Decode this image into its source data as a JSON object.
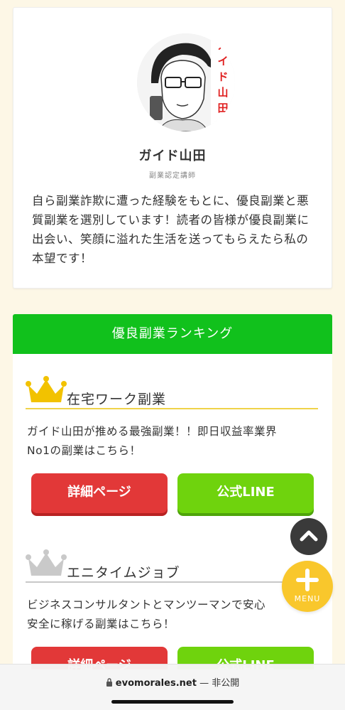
{
  "profile": {
    "avatar_text": "ガイド山田",
    "name": "ガイド山田",
    "role": "副業認定講師",
    "bio": "自ら副業詐欺に遭った経験をもとに、優良副業と悪質副業を選別しています！読者の皆様が優良副業に出会い、笑顔に溢れた生活を送ってもらえたら私の本望です！"
  },
  "ranking": {
    "header": "優良副業ランキング",
    "items": [
      {
        "title": "在宅ワーク副業",
        "desc_line1": "ガイド山田が推める最強副業！！即日収益率業界",
        "desc_line2": "No1の副業はこちら！",
        "detail_button": "詳細ページ",
        "line_button": "公式LINE",
        "crown": "gold-crown-icon"
      },
      {
        "title": "エニタイムジョブ",
        "desc_line1": "ビジネスコンサルタントとマンツーマンで安心",
        "desc_line2": "安全に稼げる副業はこちら！",
        "detail_button": "詳細ページ",
        "line_button": "公式LINE",
        "crown": "silver-crown-icon"
      }
    ]
  },
  "floating": {
    "menu_label": "MENU",
    "scroll_top_icon": "chevron-up-icon",
    "menu_icon": "plus-icon"
  },
  "browser": {
    "domain": "evomorales.net",
    "status": "— 非公開",
    "lock_icon": "lock-icon"
  },
  "colors": {
    "header_green": "#11c11c",
    "button_red": "#e23838",
    "button_green": "#6fd30d",
    "gold": "#f2c200",
    "menu_yellow": "#f9c72c",
    "page_bg": "#fdf7e6"
  }
}
